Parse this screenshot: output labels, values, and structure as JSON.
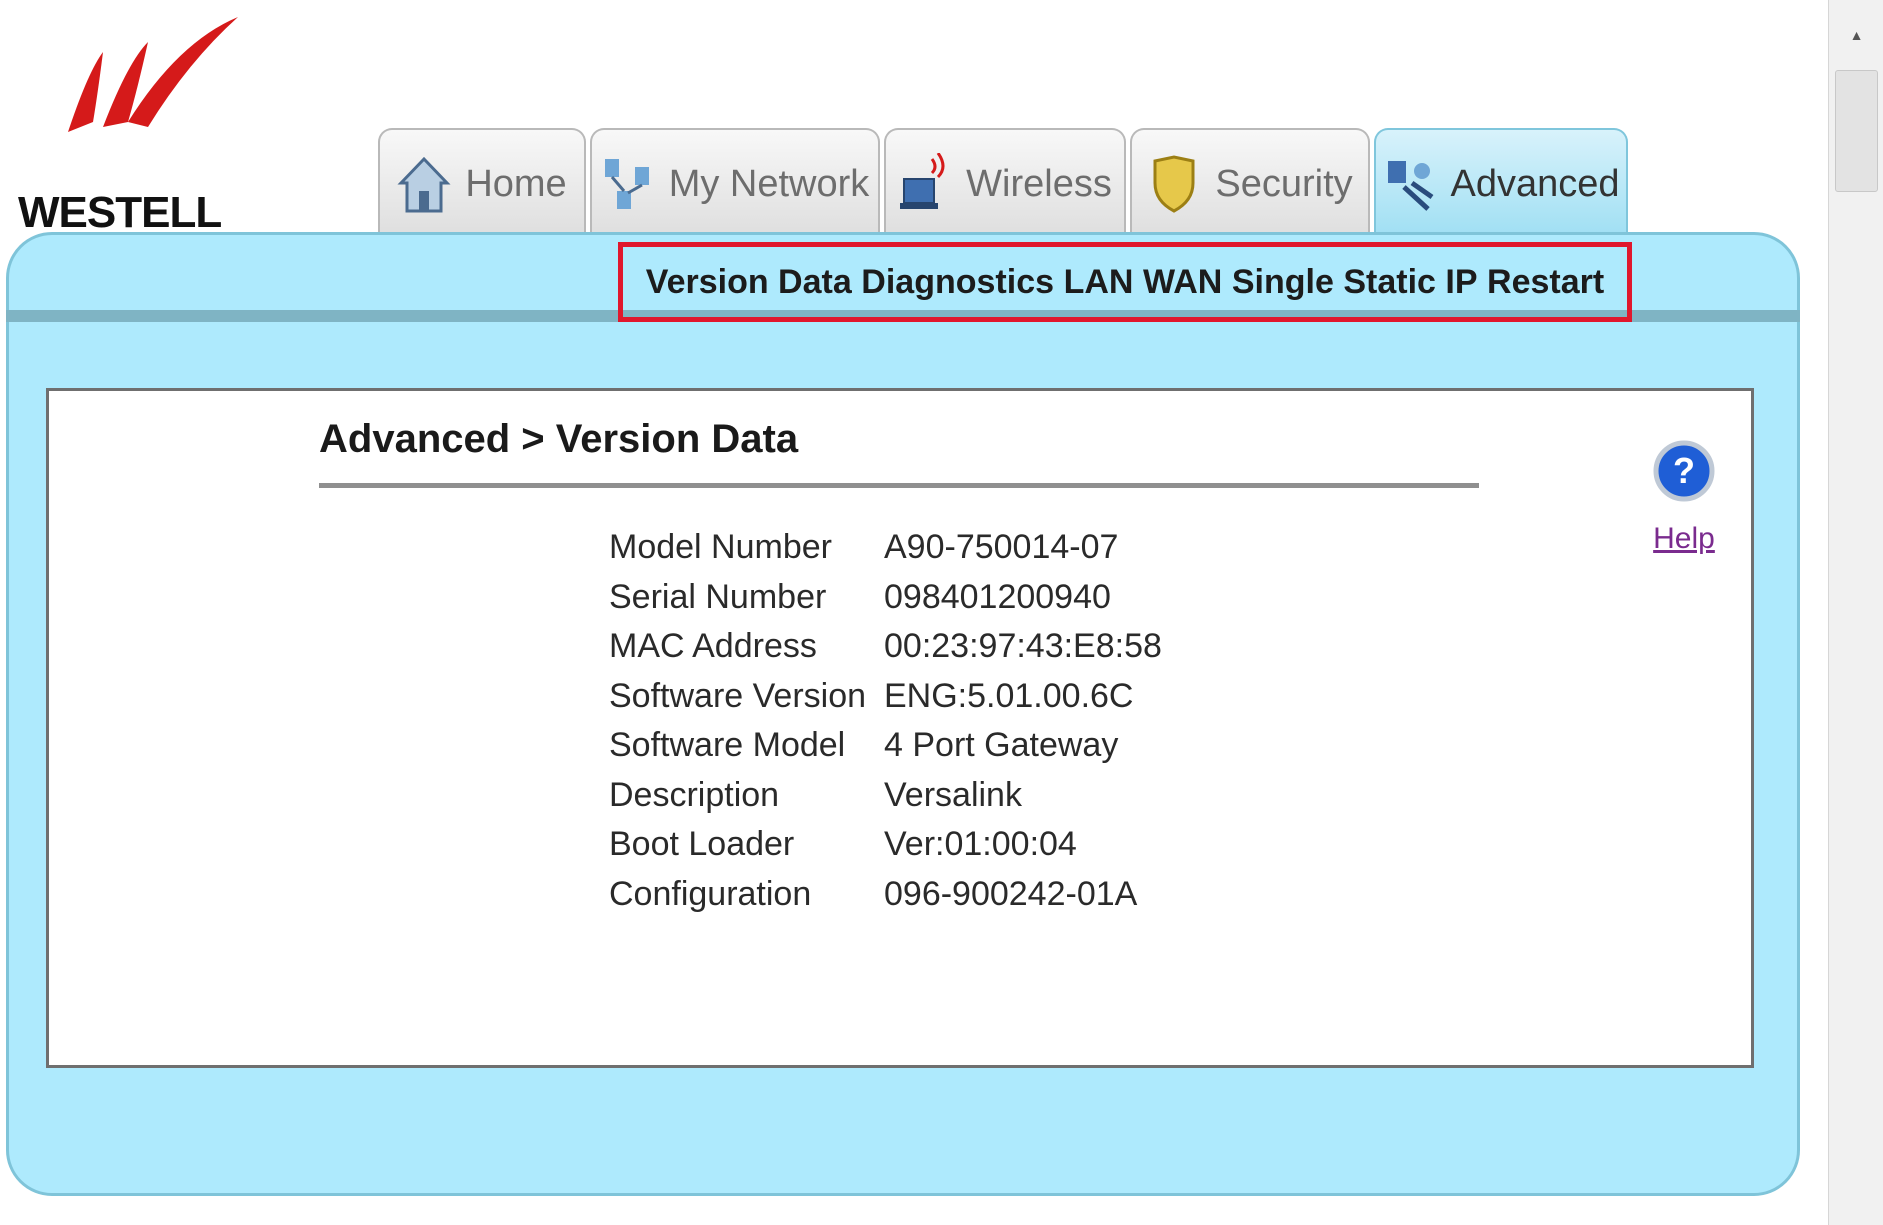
{
  "brand": {
    "name": "WESTELL",
    "logo_color": "#d51a1a"
  },
  "tabs": [
    {
      "label": "Home",
      "icon": "house-icon"
    },
    {
      "label": "My Network",
      "icon": "network-icon"
    },
    {
      "label": "Wireless",
      "icon": "wireless-computer-icon"
    },
    {
      "label": "Security",
      "icon": "shield-icon"
    },
    {
      "label": "Advanced",
      "icon": "advanced-tools-icon",
      "active": true
    }
  ],
  "subnav": [
    "Version Data",
    "Diagnostics",
    "LAN",
    "WAN",
    "Single Static IP",
    "Restart"
  ],
  "page": {
    "title": "Advanced > Version Data"
  },
  "info": [
    {
      "label": "Model Number",
      "value": "A90-750014-07"
    },
    {
      "label": "Serial Number",
      "value": "098401200940"
    },
    {
      "label": "MAC Address",
      "value": "00:23:97:43:E8:58"
    },
    {
      "label": "Software Version",
      "value": "ENG:5.01.00.6C"
    },
    {
      "label": "Software Model",
      "value": "4 Port Gateway"
    },
    {
      "label": "Description",
      "value": "Versalink"
    },
    {
      "label": "Boot Loader",
      "value": "Ver:01:00:04"
    },
    {
      "label": "Configuration",
      "value": "096-900242-01A"
    }
  ],
  "help": {
    "label": "Help",
    "icon": "help-question-icon"
  },
  "colors": {
    "frame": "#aeeafd",
    "highlight": "#e0172d",
    "active_tab": "#9fdff3"
  }
}
